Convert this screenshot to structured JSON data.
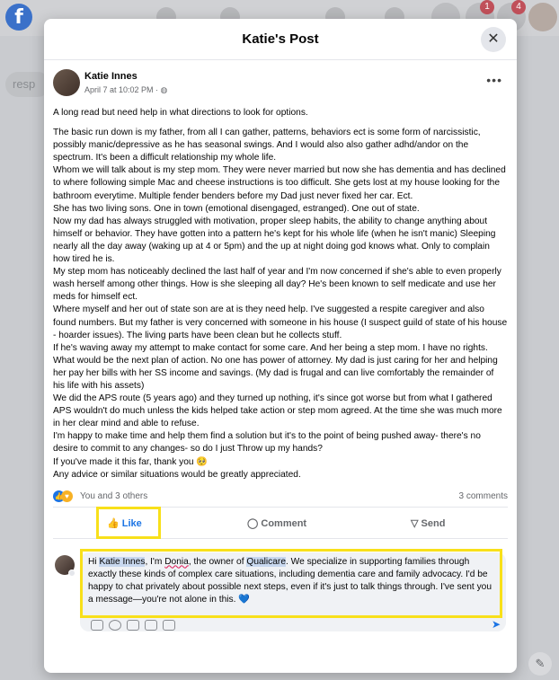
{
  "background": {
    "search_placeholder": "resp",
    "notif_badge_1": "1",
    "notif_badge_2": "4"
  },
  "modal": {
    "title": "Katie's Post",
    "close_icon": "close-icon"
  },
  "post": {
    "author": "Katie Innes",
    "date": "April 7 at 10:02 PM · ",
    "globe_icon": "globe-icon",
    "lead": "A long read but need help in what directions to look for options.",
    "paragraphs": [
      "The basic run down is my father, from all I can gather, patterns, behaviors ect is some form of narcissistic, possibly manic/depressive as he has seasonal swings. And I would also also gather adhd/andor on the spectrum. It's been a difficult relationship my whole life.",
      "Whom we will talk about is my step mom. They were never married but now she has dementia and has declined to where following simple Mac and cheese instructions is too difficult. She gets lost at my house looking for the bathroom everytime. Multiple fender benders before my Dad just never fixed her car. Ect.",
      "She has two living sons. One in town (emotional disengaged, estranged). One out of state.",
      "Now my dad has always struggled with motivation, proper sleep habits, the ability to change anything about himself or behavior. They have gotten into a pattern he's kept for his whole life (when he isn't manic) Sleeping nearly all the day away (waking up at 4 or 5pm) and the up at night doing god knows what. Only to complain how tired he is.",
      "My step mom has noticeably declined the last half of year and I'm now concerned if she's able to even properly wash herself among other things. How is she sleeping all day? He's been known to self medicate and use her meds for himself ect.",
      "Where myself and her out of state son are at is they need help. I've suggested a respite caregiver and also found numbers. But my father is very concerned with someone in his house (I suspect guild of state of his house - hoarder issues). The living parts have been clean but he collects stuff.",
      "If he's waving away my attempt to make contact for some care. And her being a step mom. I have no rights. What would be the next plan of action. No one has power of attorney. My dad is just caring for her and helping her pay her bills with her SS income and savings. (My dad is frugal and can live comfortably the remainder of his life with his assets)",
      "We did the APS route (5 years ago) and they turned up nothing, it's since got worse but from what I gathered APS wouldn't do much unless the kids helped take action or step mom agreed. At the time she was much more in her clear mind and able to refuse.",
      "I'm happy to make time and help them find a solution but it's to the point of being pushed away- there's no desire to commit to any changes- so do I just Throw up my hands?",
      "If you've made it this far, thank you 🥺",
      "Any advice or similar situations would be greatly appreciated."
    ],
    "reactions_text": "You and 3 others",
    "comments_count": "3 comments"
  },
  "actions": {
    "like": "Like",
    "comment": "Comment",
    "send": "Send"
  },
  "comment": {
    "greeting": "Hi ",
    "name": "Katie Innes",
    "mid1": ", I'm ",
    "commenter": "Donia",
    "mid2": ", the owner of ",
    "company": "Qualicare",
    "rest": ". We specialize in supporting families through exactly these kinds of complex care situations, including dementia care and family advocacy. I'd be happy to chat privately about possible next steps, even if it's just to talk things through. I've sent you a message—you're not alone in this. 💙"
  },
  "colors": {
    "accent": "#1b74e4",
    "highlight": "#f8e01a"
  }
}
